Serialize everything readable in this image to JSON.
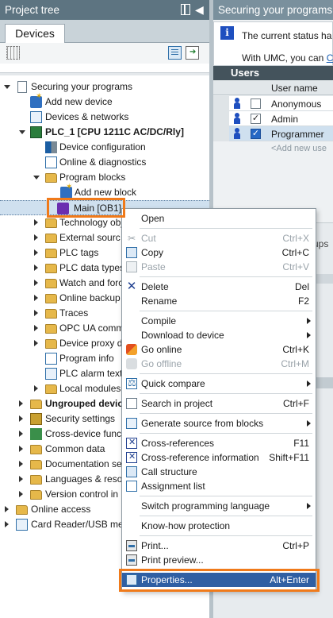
{
  "left_panel": {
    "title": "Project tree",
    "tab": "Devices",
    "tree": [
      {
        "label": "Securing your programs",
        "icon": "page-icon",
        "bold": false
      },
      {
        "label": "Add new device",
        "icon": "add-device-icon"
      },
      {
        "label": "Devices & networks",
        "icon": "network-icon"
      },
      {
        "label": "PLC_1 [CPU 1211C AC/DC/Rly]",
        "icon": "plc-icon",
        "bold": true
      },
      {
        "label": "Device configuration",
        "icon": "device-configuration-icon"
      },
      {
        "label": "Online & diagnostics",
        "icon": "diagnostics-icon"
      },
      {
        "label": "Program blocks",
        "icon": "folder-icon"
      },
      {
        "label": "Add new block",
        "icon": "add-block-icon"
      },
      {
        "label": "Main [OB1]",
        "icon": "ob-block-icon"
      },
      {
        "label": "Technology obj",
        "icon": "folder-icon"
      },
      {
        "label": "External sourc",
        "icon": "folder-icon"
      },
      {
        "label": "PLC tags",
        "icon": "folder-icon"
      },
      {
        "label": "PLC data types",
        "icon": "folder-icon"
      },
      {
        "label": "Watch and forc",
        "icon": "folder-icon"
      },
      {
        "label": "Online backup",
        "icon": "folder-icon"
      },
      {
        "label": "Traces",
        "icon": "folder-icon"
      },
      {
        "label": "OPC UA comm",
        "icon": "folder-icon"
      },
      {
        "label": "Device proxy d",
        "icon": "folder-icon"
      },
      {
        "label": "Program info",
        "icon": "info-icon"
      },
      {
        "label": "PLC alarm text",
        "icon": "alarm-text-icon"
      },
      {
        "label": "Local modules",
        "icon": "folder-icon"
      },
      {
        "label": "Ungrouped device",
        "icon": "folder-icon",
        "bold": true
      },
      {
        "label": "Security settings",
        "icon": "shield-icon"
      },
      {
        "label": "Cross-device func",
        "icon": "cross-device-icon"
      },
      {
        "label": "Common data",
        "icon": "folder-icon"
      },
      {
        "label": "Documentation se",
        "icon": "folder-icon"
      },
      {
        "label": "Languages & reso",
        "icon": "folder-icon"
      },
      {
        "label": "Version control in",
        "icon": "folder-icon"
      },
      {
        "label": "Online access",
        "icon": "folder-icon"
      },
      {
        "label": "Card Reader/USB mem",
        "icon": "card-reader-icon"
      }
    ]
  },
  "right_panel": {
    "title": "Securing your programs",
    "info_line1": "The current status ha",
    "info_line2_prefix": "With UMC, you can",
    "info_link": "Cl",
    "users_title": "Users",
    "column_user_name": "User name",
    "users": [
      {
        "name": "Anonymous",
        "checked": false
      },
      {
        "name": "Admin",
        "checked": true
      },
      {
        "name": "Programmer",
        "checked": true
      }
    ],
    "add_user": "<Add new use",
    "lower_fragment": "ups"
  },
  "context_menu": {
    "items": [
      {
        "label": "Open",
        "shortcut": "",
        "icon": "",
        "disabled": false
      },
      {
        "label": "Cut",
        "shortcut": "Ctrl+X",
        "icon": "cut-icon",
        "disabled": true
      },
      {
        "label": "Copy",
        "shortcut": "Ctrl+C",
        "icon": "copy-icon",
        "disabled": false
      },
      {
        "label": "Paste",
        "shortcut": "Ctrl+V",
        "icon": "paste-icon",
        "disabled": true
      },
      {
        "label": "Delete",
        "shortcut": "Del",
        "icon": "delete-icon",
        "disabled": false
      },
      {
        "label": "Rename",
        "shortcut": "F2",
        "icon": "",
        "disabled": false
      },
      {
        "label": "Compile",
        "shortcut": "",
        "icon": "",
        "disabled": false,
        "submenu": true
      },
      {
        "label": "Download to device",
        "shortcut": "",
        "icon": "",
        "disabled": false,
        "submenu": true
      },
      {
        "label": "Go online",
        "shortcut": "Ctrl+K",
        "icon": "go-online-icon",
        "disabled": false
      },
      {
        "label": "Go offline",
        "shortcut": "Ctrl+M",
        "icon": "go-offline-icon",
        "disabled": true
      },
      {
        "label": "Quick compare",
        "shortcut": "",
        "icon": "compare-icon",
        "disabled": false,
        "submenu": true
      },
      {
        "label": "Search in project",
        "shortcut": "Ctrl+F",
        "icon": "search-icon",
        "disabled": false
      },
      {
        "label": "Generate source from blocks",
        "shortcut": "",
        "icon": "generate-source-icon",
        "disabled": false,
        "submenu": true
      },
      {
        "label": "Cross-references",
        "shortcut": "F11",
        "icon": "cross-references-icon",
        "disabled": false
      },
      {
        "label": "Cross-reference information",
        "shortcut": "Shift+F11",
        "icon": "cross-reference-info-icon",
        "disabled": false
      },
      {
        "label": "Call structure",
        "shortcut": "",
        "icon": "call-structure-icon",
        "disabled": false
      },
      {
        "label": "Assignment list",
        "shortcut": "",
        "icon": "assignment-list-icon",
        "disabled": false
      },
      {
        "label": "Switch programming language",
        "shortcut": "",
        "icon": "",
        "disabled": false,
        "submenu": true
      },
      {
        "label": "Know-how protection",
        "shortcut": "",
        "icon": "",
        "disabled": false
      },
      {
        "label": "Print...",
        "shortcut": "Ctrl+P",
        "icon": "print-icon",
        "disabled": false
      },
      {
        "label": "Print preview...",
        "shortcut": "",
        "icon": "print-preview-icon",
        "disabled": false
      },
      {
        "label": "Properties...",
        "shortcut": "Alt+Enter",
        "icon": "properties-icon",
        "disabled": false,
        "focused": true
      }
    ]
  },
  "colors": {
    "highlight": "#f07a1a",
    "menu_focus": "#2f5fa3",
    "header": "#5d7481"
  }
}
